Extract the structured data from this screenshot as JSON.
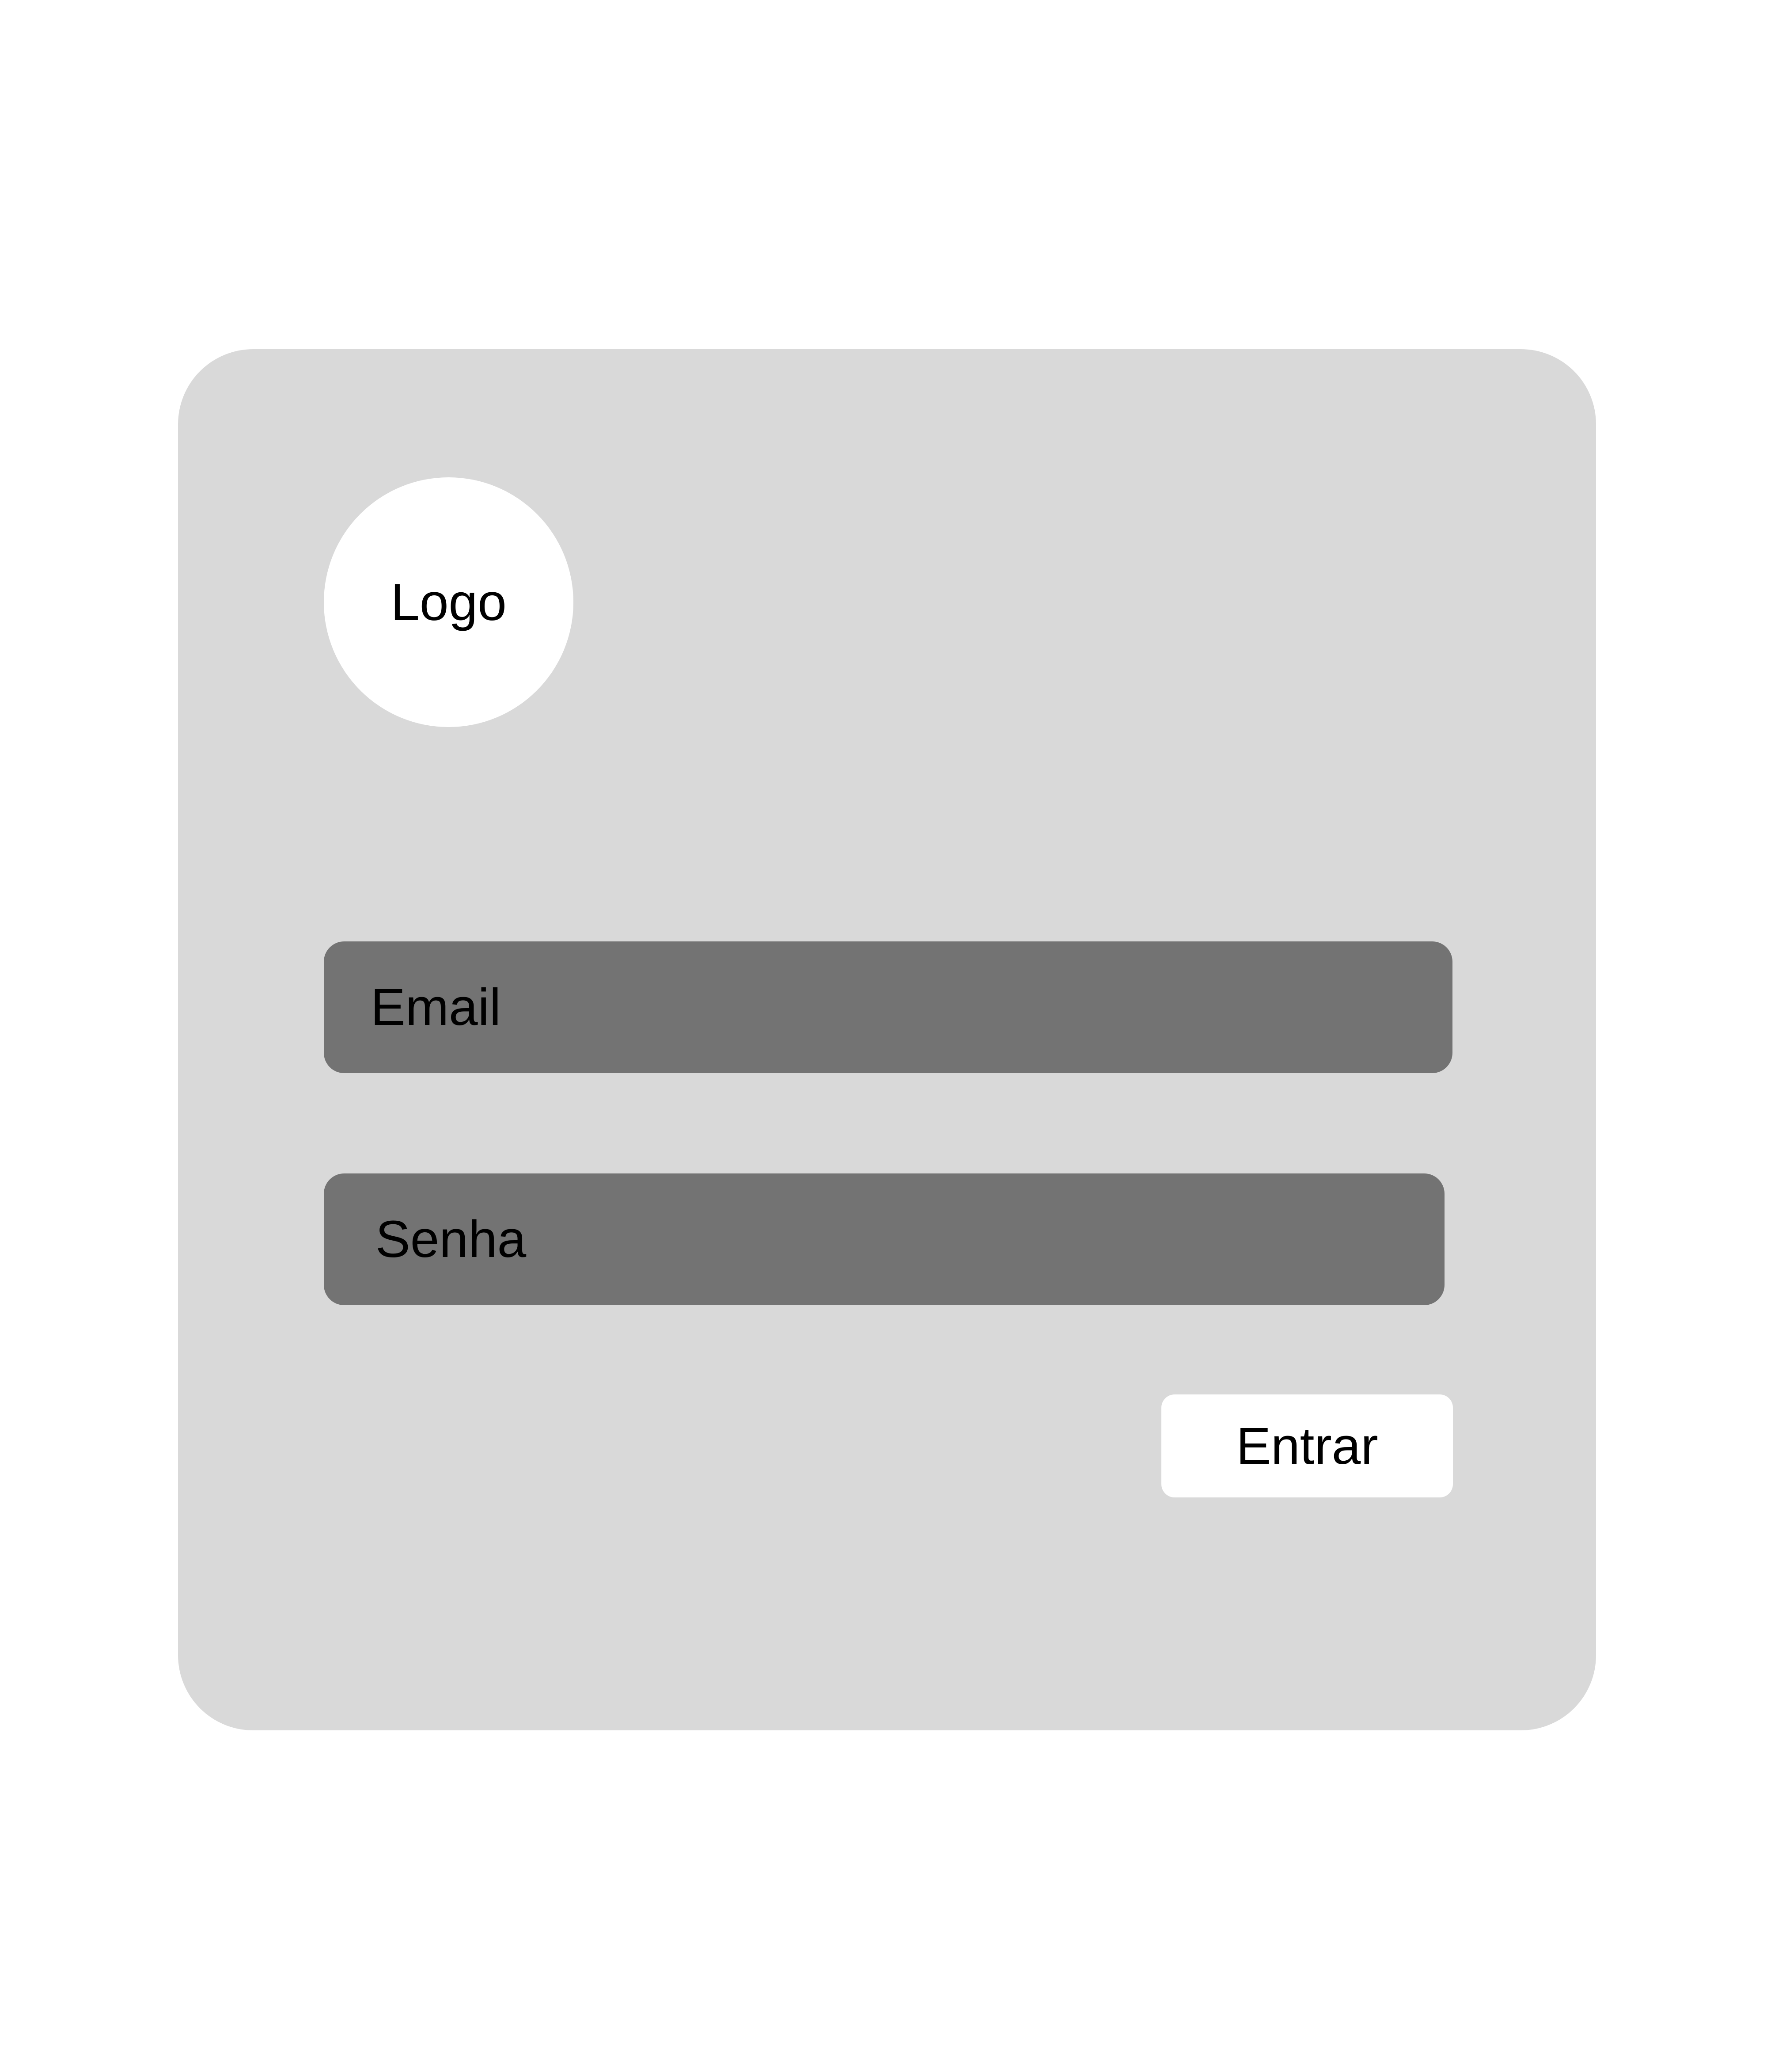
{
  "logo": {
    "label": "Logo"
  },
  "form": {
    "email_placeholder": "Email",
    "password_placeholder": "Senha",
    "submit_label": "Entrar"
  },
  "colors": {
    "page_background": "#ffffff",
    "card_background": "#d9d9d9",
    "field_background": "#737373",
    "button_background": "#ffffff",
    "text": "#000000"
  }
}
